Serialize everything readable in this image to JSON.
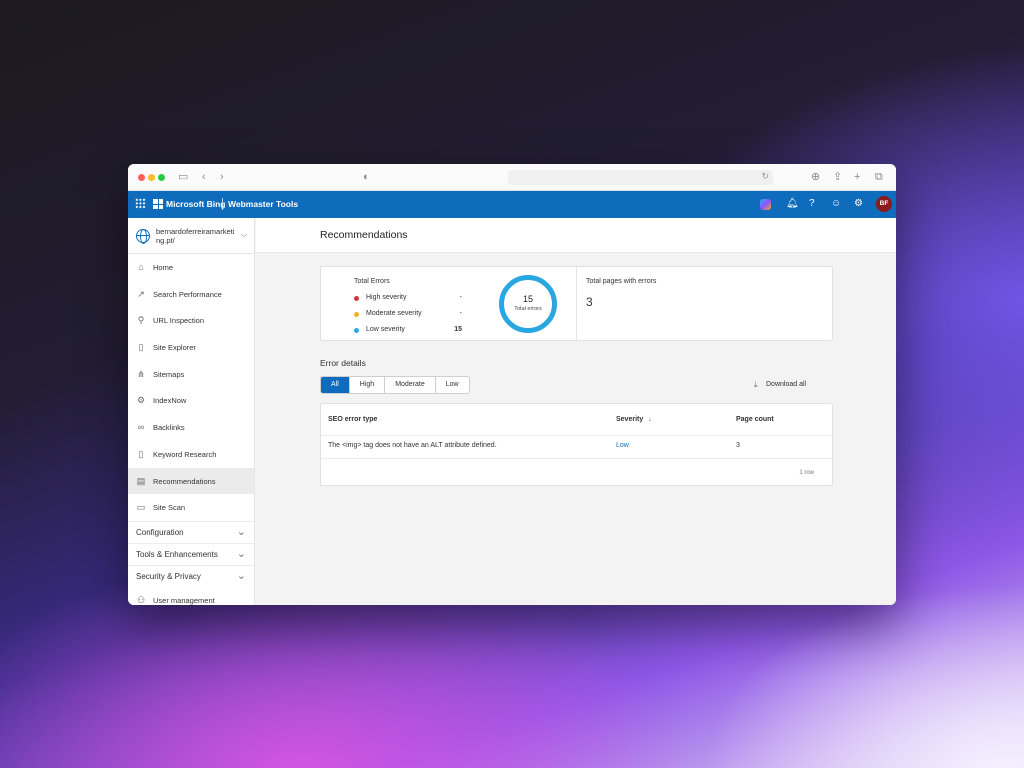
{
  "header": {
    "brand": "Microsoft Bing",
    "product": "Webmaster Tools",
    "avatar_initials": "BF"
  },
  "sidebar": {
    "site": "bernardoferreiramarketing.pt/",
    "items": [
      {
        "label": "Home",
        "icon": "home-icon"
      },
      {
        "label": "Search Performance",
        "icon": "trend-icon"
      },
      {
        "label": "URL Inspection",
        "icon": "search-icon"
      },
      {
        "label": "Site Explorer",
        "icon": "document-icon"
      },
      {
        "label": "Sitemaps",
        "icon": "sitemap-icon"
      },
      {
        "label": "IndexNow",
        "icon": "gear-icon"
      },
      {
        "label": "Backlinks",
        "icon": "link-icon"
      },
      {
        "label": "Keyword Research",
        "icon": "document-icon"
      },
      {
        "label": "Recommendations",
        "icon": "document-icon"
      },
      {
        "label": "Site Scan",
        "icon": "scan-icon"
      }
    ],
    "groups": [
      {
        "label": "Configuration"
      },
      {
        "label": "Tools & Enhancements"
      },
      {
        "label": "Security & Privacy"
      }
    ],
    "footer_item": "User management"
  },
  "page": {
    "title": "Recommendations"
  },
  "summary": {
    "total_errors_label": "Total Errors",
    "severities": [
      {
        "label": "High severity",
        "value": "-",
        "color": "#d13438"
      },
      {
        "label": "Moderate severity",
        "value": "-",
        "color": "#f2b01e"
      },
      {
        "label": "Low severity",
        "value": "15",
        "color": "#2aa7e0"
      }
    ],
    "donut_value": "15",
    "donut_label": "Total errors",
    "pages_label": "Total pages with errors",
    "pages_value": "3"
  },
  "details": {
    "title": "Error details",
    "filters": [
      "All",
      "High",
      "Moderate",
      "Low"
    ],
    "download_label": "Download all",
    "columns": [
      "SEO error type",
      "Severity",
      "Page count"
    ],
    "rows": [
      {
        "type": "The <img> tag does not have an ALT attribute defined.",
        "severity": "Low",
        "count": "3"
      }
    ],
    "row_count": "1 row"
  },
  "colors": {
    "accent": "#0f6cbd",
    "donut": "#2aa7e0"
  }
}
